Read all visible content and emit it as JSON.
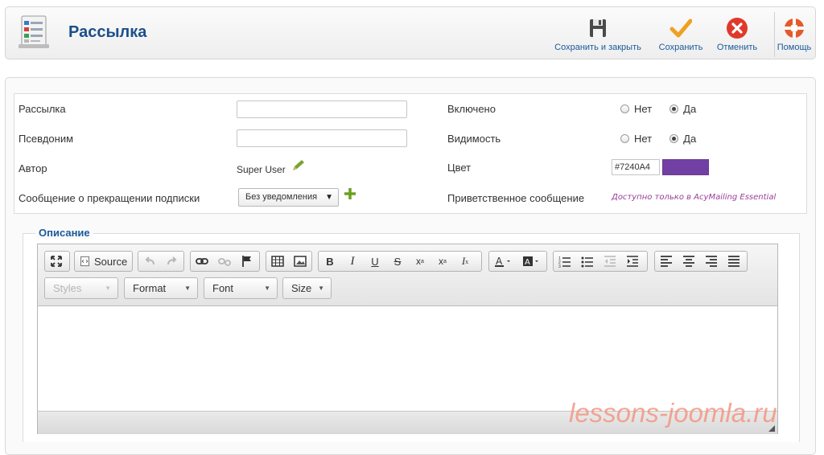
{
  "header": {
    "title": "Рассылка",
    "buttons": {
      "save_close": "Сохранить и закрыть",
      "save": "Сохранить",
      "cancel": "Отменить",
      "help": "Помощь"
    }
  },
  "form": {
    "list_label": "Рассылка",
    "list_value": "",
    "alias_label": "Псевдоним",
    "alias_value": "",
    "author_label": "Автор",
    "author_value": "Super User",
    "unsub_label": "Сообщение о прекращении подписки",
    "unsub_value": "Без уведомления",
    "enabled_label": "Включено",
    "visible_label": "Видимость",
    "radio_no": "Нет",
    "radio_yes": "Да",
    "enabled_value": "Да",
    "visible_value": "Да",
    "color_label": "Цвет",
    "color_value": "#7240A4",
    "welcome_label": "Приветственное сообщение",
    "welcome_note": "Доступно только в AcyMailing Essential"
  },
  "editor": {
    "legend": "Описание",
    "source_label": "Source",
    "styles_label": "Styles",
    "format_label": "Format",
    "font_label": "Font",
    "size_label": "Size"
  },
  "icons": {
    "logo": "newsletter-list-icon",
    "save_close": "floppy-disk-icon",
    "save": "checkmark-icon",
    "cancel": "cancel-x-icon",
    "help": "lifebuoy-icon"
  },
  "colors": {
    "accent": "#1a4f8b",
    "swatch": "#7240A4",
    "check": "#f0a020",
    "cancel": "#e0392b",
    "help": "#e45a2a"
  },
  "watermark": "lessons-joomla.ru"
}
